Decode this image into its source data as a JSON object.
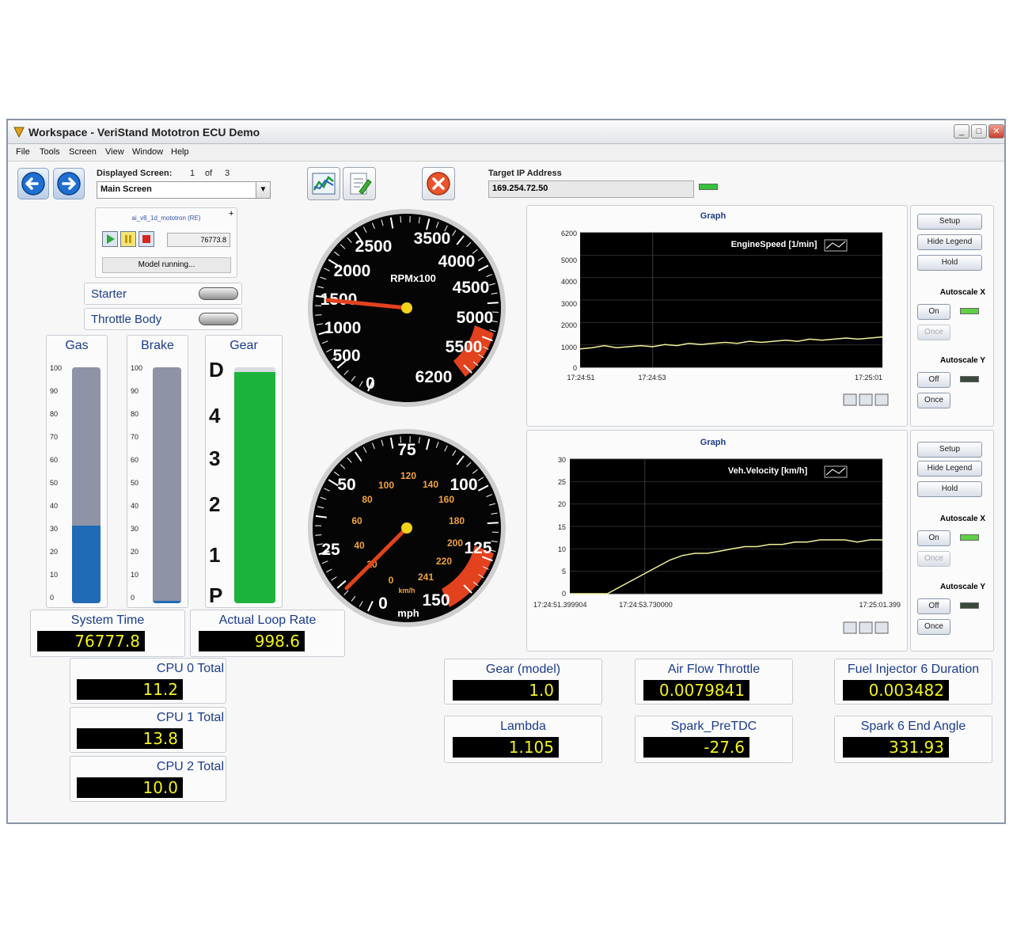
{
  "window": {
    "title": "Workspace - VeriStand Mototron ECU Demo",
    "controls": [
      "_",
      "□",
      "✕"
    ]
  },
  "menu": [
    "File",
    "Tools",
    "Screen",
    "View",
    "Window",
    "Help"
  ],
  "toolbar": {
    "displayed_screen_label": "Displayed Screen:",
    "screen_index": "1",
    "of_label": "of",
    "screen_total": "3",
    "screen_select_value": "Main Screen",
    "target_ip_label": "Target IP Address",
    "target_ip_value": "169.254.72.50",
    "ip_status_color": "#36c23a"
  },
  "model_panel": {
    "name": "ai_v8_1d_mototron (RE)",
    "value": "76773.8",
    "status": "Model running..."
  },
  "toggles": {
    "starter": "Starter",
    "throttle_body": "Throttle Body"
  },
  "sliders": {
    "gas": {
      "label": "Gas",
      "value": 33,
      "color": "#1f6bb5"
    },
    "brake": {
      "label": "Brake",
      "value": 1,
      "color": "#1f6bb5"
    },
    "scale": [
      "100",
      "90",
      "80",
      "70",
      "60",
      "50",
      "40",
      "30",
      "20",
      "10",
      "0"
    ]
  },
  "gear_indicator": {
    "label": "Gear",
    "positions": [
      "D",
      "4",
      "3",
      "2",
      "1",
      "P"
    ],
    "level": 98,
    "color": "#1cb33c"
  },
  "tach": {
    "unit": "RPMx100",
    "labels": [
      "0",
      "500",
      "1000",
      "1500",
      "2000",
      "2500",
      "3500",
      "4000",
      "4500",
      "5000",
      "5500",
      "6200"
    ],
    "value": 1500
  },
  "speedo": {
    "outer_labels": [
      "0",
      "25",
      "50",
      "75",
      "100",
      "125",
      "150"
    ],
    "inner_labels": [
      "0",
      "20",
      "40",
      "60",
      "80",
      "100",
      "120",
      "140",
      "160",
      "180",
      "200",
      "220",
      "241"
    ],
    "unit_mph": "mph",
    "unit_kmh": "km/h",
    "value_kmh": 20
  },
  "system": {
    "system_time_label": "System Time",
    "system_time_value": "76777.8",
    "loop_rate_label": "Actual Loop Rate",
    "loop_rate_value": "998.6"
  },
  "cpu": [
    {
      "label": "CPU 0 Total",
      "value": "11.2"
    },
    {
      "label": "CPU 1 Total",
      "value": "13.8"
    },
    {
      "label": "CPU 2 Total",
      "value": "10.0"
    }
  ],
  "indicators": [
    {
      "label": "Gear (model)",
      "value": "1.0"
    },
    {
      "label": "Air Flow Throttle",
      "value": "0.0079841"
    },
    {
      "label": "Fuel Injector 6 Duration",
      "value": "0.003482"
    },
    {
      "label": "Lambda",
      "value": "1.105"
    },
    {
      "label": "Spark_PreTDC",
      "value": "-27.6"
    },
    {
      "label": "Spark 6 End Angle",
      "value": "331.93"
    }
  ],
  "graph_controls": {
    "setup": "Setup",
    "hide_legend": "Hide Legend",
    "hold": "Hold",
    "autoscale_x": "Autoscale X",
    "autoscale_y": "Autoscale Y",
    "on": "On",
    "off": "Off",
    "once": "Once",
    "led_on_color": "#5fd046",
    "led_off_color": "#3a4a3a"
  },
  "chart_data": [
    {
      "type": "line",
      "title": "Graph",
      "series": [
        {
          "name": "EngineSpeed [1/min]",
          "x": [
            0,
            4,
            8,
            12,
            16,
            20,
            24,
            28,
            32,
            36,
            40,
            44,
            48,
            52,
            56,
            60,
            64,
            68,
            72,
            76,
            80,
            84,
            88,
            92,
            96,
            100
          ],
          "values": [
            850,
            900,
            1000,
            900,
            950,
            1000,
            950,
            1050,
            1000,
            1100,
            1050,
            1100,
            1150,
            1100,
            1200,
            1150,
            1200,
            1250,
            1200,
            1300,
            1250,
            1300,
            1350,
            1300,
            1350,
            1400
          ]
        }
      ],
      "ylim": [
        0,
        6200
      ],
      "yticks": [
        "6200",
        "5000",
        "4000",
        "3000",
        "2000",
        "1000",
        "0"
      ],
      "xticks": [
        "17:24:51",
        "17:24:53",
        "17:25:01"
      ],
      "line_color": "#f1f19a",
      "grid": true
    },
    {
      "type": "line",
      "title": "Graph",
      "series": [
        {
          "name": "Veh.Velocity [km/h]",
          "x": [
            0,
            10,
            12,
            16,
            20,
            24,
            28,
            32,
            36,
            40,
            44,
            48,
            52,
            56,
            60,
            64,
            68,
            72,
            76,
            80,
            84,
            88,
            92,
            96,
            100
          ],
          "values": [
            0,
            0,
            0,
            1.5,
            3,
            4.5,
            6,
            7.5,
            8.5,
            9,
            9,
            9.5,
            10,
            10.5,
            10.5,
            11,
            11,
            11.5,
            11.5,
            12,
            12,
            12,
            11.5,
            12,
            12
          ]
        }
      ],
      "ylim": [
        0,
        30
      ],
      "yticks": [
        "30",
        "25",
        "20",
        "15",
        "10",
        "5",
        "0"
      ],
      "xticks": [
        "17:24:51.399904",
        "17:24:53.730000",
        "17:25:01.399"
      ],
      "line_color": "#f1f19a",
      "grid": true
    }
  ]
}
